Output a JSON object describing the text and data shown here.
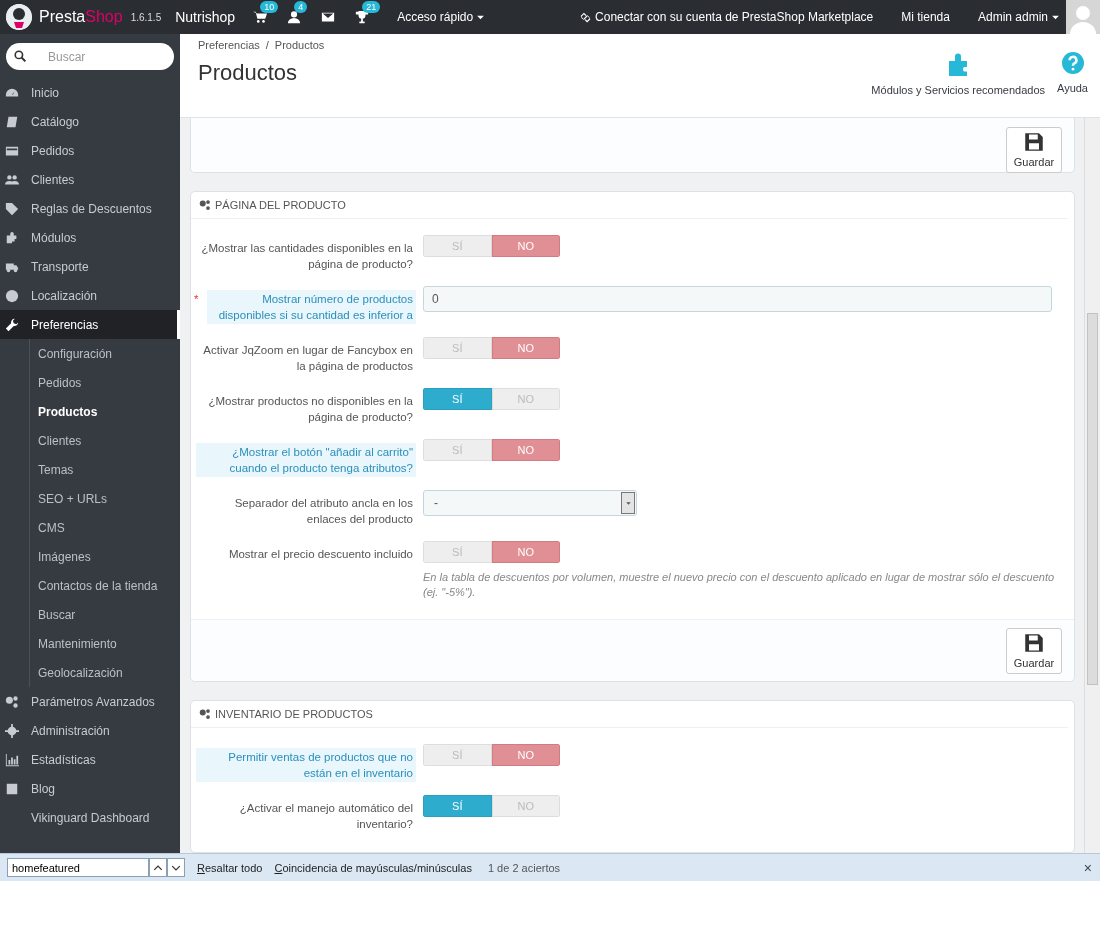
{
  "topbar": {
    "brand_parts": [
      "Presta",
      "Shop"
    ],
    "version": "1.6.1.5",
    "shop": "Nutrishop",
    "notifications": [
      {
        "kind": "cart",
        "count": "10"
      },
      {
        "kind": "customer",
        "count": "4"
      },
      {
        "kind": "message"
      },
      {
        "kind": "trophy",
        "count": "21"
      }
    ],
    "quick_access": "Acceso rápido",
    "marketplace": "Conectar con su cuenta de PrestaShop Marketplace",
    "my_shop": "Mi tienda",
    "user": "Admin admin"
  },
  "sidebar": {
    "search": {
      "placeholder": "Buscar"
    },
    "items": [
      {
        "label": "Inicio",
        "selected": false
      },
      {
        "label": "Catálogo",
        "selected": false
      },
      {
        "label": "Pedidos",
        "selected": false
      },
      {
        "label": "Clientes",
        "selected": false
      },
      {
        "label": "Reglas de Descuentos",
        "selected": false
      },
      {
        "label": "Módulos",
        "selected": false
      },
      {
        "label": "Transporte",
        "selected": false
      },
      {
        "label": "Localización",
        "selected": false
      },
      {
        "label": "Preferencias",
        "selected": true,
        "children": [
          {
            "label": "Configuración",
            "selected": false
          },
          {
            "label": "Pedidos",
            "selected": false
          },
          {
            "label": "Productos",
            "selected": true
          },
          {
            "label": "Clientes",
            "selected": false
          },
          {
            "label": "Temas",
            "selected": false
          },
          {
            "label": "SEO + URLs",
            "selected": false
          },
          {
            "label": "CMS",
            "selected": false
          },
          {
            "label": "Imágenes",
            "selected": false
          },
          {
            "label": "Contactos de la tienda",
            "selected": false
          },
          {
            "label": "Buscar",
            "selected": false
          },
          {
            "label": "Mantenimiento",
            "selected": false
          },
          {
            "label": "Geolocalización",
            "selected": false
          }
        ]
      },
      {
        "label": "Parámetros Avanzados",
        "selected": false
      },
      {
        "label": "Administración",
        "selected": false
      },
      {
        "label": "Estadísticas",
        "selected": false
      },
      {
        "label": "Blog",
        "selected": false
      },
      {
        "label": "Vikinguard Dashboard",
        "selected": false
      }
    ]
  },
  "header": {
    "breadcrumb": [
      "Preferencias",
      "Productos"
    ],
    "breadcrumb_separator": "/",
    "title": "Productos",
    "toolbar": [
      "Módulos y Servicios recomendados",
      "Ayuda"
    ]
  },
  "panels": [
    {
      "save": "Guardar"
    },
    {
      "title": "PÁGINA DEL PRODUCTO",
      "save": "Guardar",
      "rows": [
        {
          "kind": "switch",
          "label": "¿Mostrar las cantidades disponibles en la página de producto?",
          "hint": false,
          "options": [
            {
              "label": "SÍ",
              "selected": false
            },
            {
              "label": "NO",
              "selected": true
            }
          ]
        },
        {
          "kind": "input",
          "label": "Mostrar número de productos disponibles si su cantidad es inferior a",
          "hint": true,
          "required": true,
          "required_mark": "*",
          "value": "0"
        },
        {
          "kind": "switch",
          "label": "Activar JqZoom en lugar de Fancybox en la página de productos",
          "hint": false,
          "options": [
            {
              "label": "SÍ",
              "selected": false
            },
            {
              "label": "NO",
              "selected": true
            }
          ]
        },
        {
          "kind": "switch",
          "label": "¿Mostrar productos no disponibles en la página de producto?",
          "hint": false,
          "options": [
            {
              "label": "SÍ",
              "selected": true
            },
            {
              "label": "NO",
              "selected": false
            }
          ]
        },
        {
          "kind": "switch",
          "label": "¿Mostrar el botón \"añadir al carrito\" cuando el producto tenga atributos?",
          "hint": true,
          "options": [
            {
              "label": "SÍ",
              "selected": false
            },
            {
              "label": "NO",
              "selected": true
            }
          ]
        },
        {
          "kind": "select",
          "label": "Separador del atributo ancla en los enlaces del producto",
          "hint": false,
          "value": "-"
        },
        {
          "kind": "switch",
          "label": "Mostrar el precio descuento incluido",
          "hint": false,
          "options": [
            {
              "label": "SÍ",
              "selected": false
            },
            {
              "label": "NO",
              "selected": true
            }
          ],
          "help": "En la tabla de descuentos por volumen, muestre el nuevo precio con el descuento aplicado en lugar de mostrar sólo el descuento (ej. \"-5%\")."
        }
      ]
    },
    {
      "title": "INVENTARIO DE PRODUCTOS",
      "rows": [
        {
          "kind": "switch",
          "label": "Permitir ventas de productos que no están en el inventario",
          "hint": true,
          "options": [
            {
              "label": "SÍ",
              "selected": false
            },
            {
              "label": "NO",
              "selected": true
            }
          ]
        },
        {
          "kind": "switch",
          "label": "¿Activar el manejo automático del inventario?",
          "hint": false,
          "options": [
            {
              "label": "SÍ",
              "selected": true
            },
            {
              "label": "NO",
              "selected": false
            }
          ]
        }
      ]
    }
  ],
  "find_bar": {
    "value": "homefeatured",
    "highlight_all": "Resaltar todo",
    "match_case": "Coincidencia de mayúsculas/minúsculas",
    "result": "1 de 2 aciertos",
    "close": "×"
  }
}
